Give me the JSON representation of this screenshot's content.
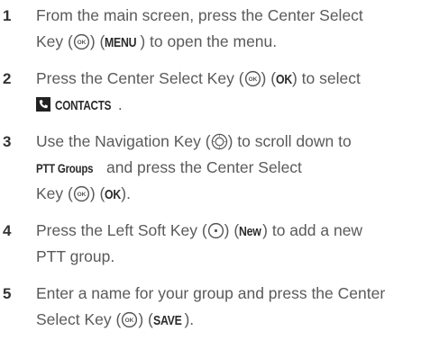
{
  "steps": [
    {
      "number": "1",
      "line1": {
        "a": "From the main screen, press the Center Select"
      },
      "line2": {
        "a": "Key (",
        "b": ") (",
        "kw": "MENU",
        "c": ") to open the menu."
      }
    },
    {
      "number": "2",
      "line1": {
        "a": "Press the Center Select Key (",
        "b": ") (",
        "kw": "OK",
        "c": ") to select"
      },
      "line2": {
        "kw": "CONTACTS",
        "c": "."
      }
    },
    {
      "number": "3",
      "line1": {
        "a": "Use the Navigation Key (",
        "b": ") to scroll down to"
      },
      "line2": {
        "kw": "PTT Groups",
        "c": " and press the Center Select"
      },
      "line3": {
        "a": "Key (",
        "b": ") (",
        "kw": "OK",
        "c": ")."
      }
    },
    {
      "number": "4",
      "line1": {
        "a": "Press the Left Soft Key (",
        "b": ") (",
        "kw": "New",
        "c": ") to add a new"
      },
      "line2": {
        "a": "PTT group."
      }
    },
    {
      "number": "5",
      "line1": {
        "a": "Enter a name for your group and press the Center"
      },
      "line2": {
        "a": "Select Key (",
        "b": ") (",
        "kw": "SAVE",
        "c": ")."
      }
    }
  ],
  "icons": {
    "center_select": "ok-key-icon",
    "navigation": "navigation-key-icon",
    "left_soft": "left-soft-key-icon",
    "contacts": "contacts-icon"
  },
  "colors": {
    "body_text": "#5a5a5a",
    "numbers": "#333333",
    "keywords": "#2a2a2a"
  }
}
